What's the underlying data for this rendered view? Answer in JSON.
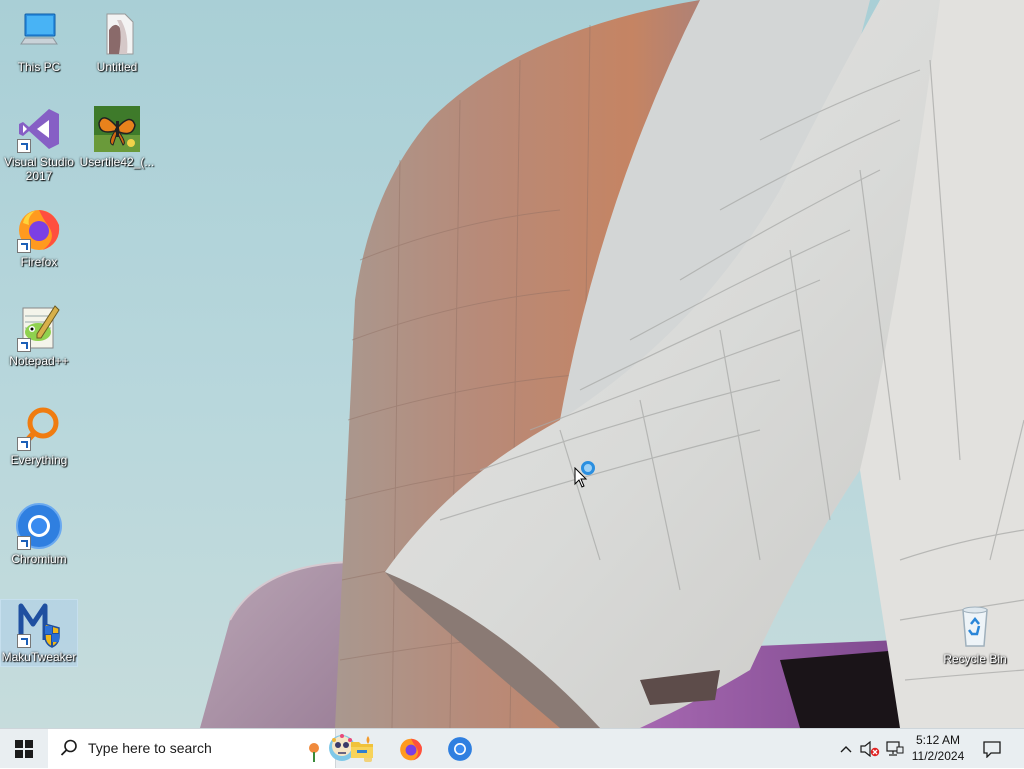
{
  "desktop": {
    "icons": [
      {
        "label": "This PC",
        "name": "this-pc-icon"
      },
      {
        "label": "Untitled",
        "name": "untitled-file-icon"
      },
      {
        "label": "Visual Studio 2017",
        "name": "visual-studio-icon"
      },
      {
        "label": "Usertile42_(...",
        "name": "usertile-image-icon"
      },
      {
        "label": "Firefox",
        "name": "firefox-icon"
      },
      {
        "label": "Notepad++",
        "name": "notepadpp-icon"
      },
      {
        "label": "Everything",
        "name": "everything-search-icon"
      },
      {
        "label": "Chromium",
        "name": "chromium-icon"
      },
      {
        "label": "MakuTweaker",
        "name": "makutweaker-icon"
      },
      {
        "label": "Recycle Bin",
        "name": "recycle-bin-icon"
      }
    ]
  },
  "taskbar": {
    "search_placeholder": "Type here to search",
    "pinned": [
      "file-explorer-icon",
      "firefox-icon",
      "chromium-icon"
    ],
    "tray": [
      "show-hidden-icons-chevron",
      "volume-muted-icon",
      "network-icon"
    ],
    "clock": {
      "time": "5:12 AM",
      "date": "11/2/2024"
    }
  },
  "colors": {
    "taskbar_bg": "#e9eef1",
    "search_bg": "#ffffff",
    "start_blue": "#1e6fd0"
  }
}
